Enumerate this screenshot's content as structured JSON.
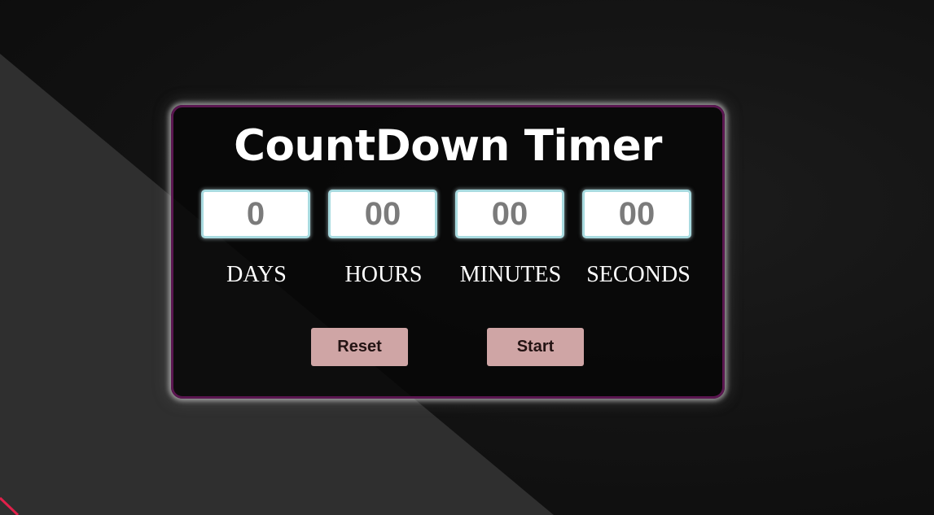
{
  "timer": {
    "title": "CountDown Timer",
    "fields": [
      {
        "value": "0",
        "label": "DAYS"
      },
      {
        "value": "00",
        "label": "HOURS"
      },
      {
        "value": "00",
        "label": "MINUTES"
      },
      {
        "value": "00",
        "label": "SECONDS"
      }
    ],
    "buttons": {
      "reset_label": "Reset",
      "start_label": "Start"
    }
  },
  "colors": {
    "background": "#111111",
    "diagonal_panel": "#303030",
    "accent_line": "#e0204a",
    "card_border": "#5a1650",
    "input_border": "#a9dbe0",
    "button_bg": "#cfa5a5"
  }
}
